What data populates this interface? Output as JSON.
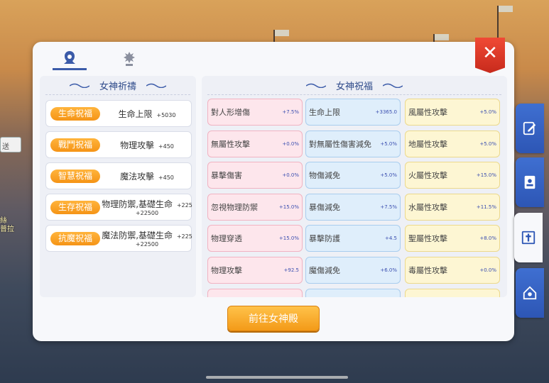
{
  "background": {
    "left_text": "絲\n普拉",
    "left_box_text": "送"
  },
  "tabs": [
    {
      "icon": "goddess-portrait-icon"
    },
    {
      "icon": "goddess-statue-icon"
    }
  ],
  "left_section": {
    "title": "女神祈禱",
    "blessings": [
      {
        "tag": "生命祝福",
        "name": "生命上限",
        "value": "+5030",
        "value2": ""
      },
      {
        "tag": "戰鬥祝福",
        "name": "物理攻擊",
        "value": "+450",
        "value2": ""
      },
      {
        "tag": "智慧祝福",
        "name": "魔法攻擊",
        "value": "+450",
        "value2": ""
      },
      {
        "tag": "生存祝福",
        "name": "物理防禦,基礎生命",
        "value": "+225",
        "value2": "+22500"
      },
      {
        "tag": "抗魔祝福",
        "name": "魔法防禦,基礎生命",
        "value": "+225",
        "value2": "+22500"
      }
    ]
  },
  "right_section": {
    "title": "女神祝福",
    "columns": [
      [
        {
          "name": "對人形增傷",
          "value": "+7.5%"
        },
        {
          "name": "無屬性攻擊",
          "value": "+0.0%"
        },
        {
          "name": "暴擊傷害",
          "value": "+0.0%"
        },
        {
          "name": "忽視物理防禦",
          "value": "+15.0%"
        },
        {
          "name": "物理穿透",
          "value": "+15.0%"
        },
        {
          "name": "物理攻擊",
          "value": "+92.5"
        }
      ],
      [
        {
          "name": "生命上限",
          "value": "+3365.0"
        },
        {
          "name": "對無屬性傷害減免",
          "value": "+5.0%"
        },
        {
          "name": "物傷減免",
          "value": "+5.0%"
        },
        {
          "name": "暴傷減免",
          "value": "+7.5%"
        },
        {
          "name": "暴擊防護",
          "value": "+4.5"
        },
        {
          "name": "魔傷減免",
          "value": "+6.0%"
        }
      ],
      [
        {
          "name": "風屬性攻擊",
          "value": "+5.0%"
        },
        {
          "name": "地屬性攻擊",
          "value": "+5.0%"
        },
        {
          "name": "火屬性攻擊",
          "value": "+15.0%"
        },
        {
          "name": "水屬性攻擊",
          "value": "+11.5%"
        },
        {
          "name": "聖屬性攻擊",
          "value": "+8.0%"
        },
        {
          "name": "毒屬性攻擊",
          "value": "+0.0%"
        }
      ]
    ]
  },
  "action_button": "前往女神殿",
  "close_label": "✕",
  "side_tabs": [
    {
      "icon": "edit-icon"
    },
    {
      "icon": "contacts-book-icon"
    },
    {
      "icon": "temple-icon"
    },
    {
      "icon": "guild-house-icon"
    }
  ],
  "colors": {
    "accent_blue": "#3b5ba9",
    "pill_orange": "#f59416",
    "close_red": "#e03a2a"
  }
}
